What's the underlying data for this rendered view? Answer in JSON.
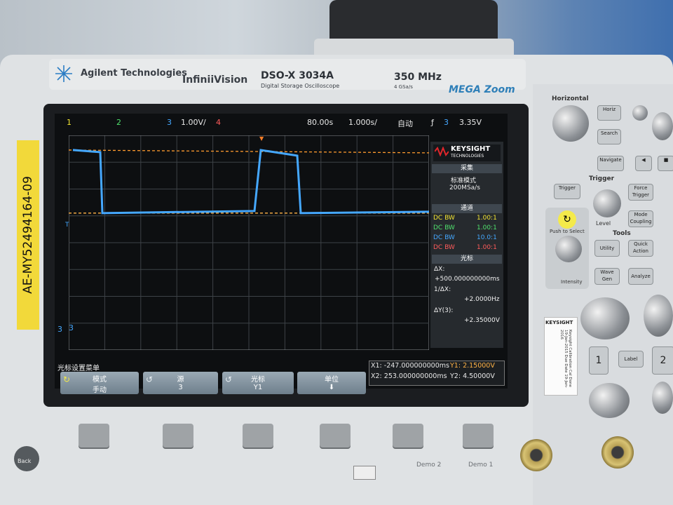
{
  "header": {
    "brand": "Agilent Technologies",
    "series": "InfiniiVision",
    "model": "DSO-X 3034A",
    "model_sub": "Digital Storage Oscilloscope",
    "bandwidth": "350 MHz",
    "sample_rate": "4 GSa/s",
    "feature": "MEGA Zoom"
  },
  "asset_tag": "AE-MY52494164-09",
  "status_bar": {
    "ch1": "1",
    "ch2": "2",
    "ch3": "3",
    "ch3_scale": "1.00V/",
    "ch4": "4",
    "h_position": "80.00s",
    "time_div": "1.000s/",
    "trigger_mode": "自动",
    "trigger_icon": "ƒ",
    "trigger_source": "3",
    "trigger_level": "3.35V"
  },
  "right_panel": {
    "logo_name": "KEYSIGHT",
    "logo_sub": "TECHNOLOGIES",
    "acq_head": "采集",
    "acq_mode": "标准模式",
    "acq_rate": "200MSa/s",
    "channel_head": "通道",
    "channels": [
      {
        "coupling": "DC BW",
        "probe": "1.00:1",
        "color": "#f2e533"
      },
      {
        "coupling": "DC BW",
        "probe": "1.00:1",
        "color": "#4fe16c"
      },
      {
        "coupling": "DC BW",
        "probe": "10.0:1",
        "color": "#45a8ff"
      },
      {
        "coupling": "DC BW",
        "probe": "1.00:1",
        "color": "#ff5b5b"
      }
    ],
    "cursor_head": "光标",
    "delta_x_label": "ΔX:",
    "delta_x": "+500.000000000ms",
    "inv_delta_x_label": "1/ΔX:",
    "inv_delta_x": "+2.0000Hz",
    "delta_y_label": "ΔY(3):",
    "delta_y": "+2.35000V"
  },
  "bottom_bar": {
    "menu_title": "光标设置菜单",
    "softkeys": [
      {
        "label": "模式",
        "value": "手动"
      },
      {
        "label": "源",
        "value": "3"
      },
      {
        "label": "光标",
        "value": "Y1"
      },
      {
        "label": "单位",
        "value": "⬇"
      }
    ],
    "cursors": {
      "x1": "X1: -247.000000000ms",
      "x2": "X2: 253.000000000ms",
      "y1": "Y1: 2.15000V",
      "y2": "Y2: 4.50000V"
    }
  },
  "markers": {
    "trigger_t": "T",
    "ground_3": "3"
  },
  "waveform": {
    "channel": 3,
    "color": "#45a8ff",
    "volts_per_div": 1.0,
    "low_level_v": 2.15,
    "high_level_v": 4.5,
    "cursor_y1_v": 2.15,
    "cursor_y2_v": 4.5
  },
  "controls": {
    "horizontal": "Horizontal",
    "horiz_btn": "Horiz",
    "search_btn": "Search",
    "navigate_btn": "Navigate",
    "trigger": "Trigger",
    "trigger_btn": "Trigger",
    "force_trigger_btn": "Force Trigger",
    "level": "Level",
    "mode_coupling_btn": "Mode Coupling",
    "push_to_select": "Push to Select",
    "tools": "Tools",
    "utility_btn": "Utility",
    "quick_action_btn": "Quick Action",
    "wave_gen_btn": "Wave Gen",
    "analyze_btn": "Analyze",
    "label_btn": "Label",
    "ch1_btn": "1",
    "ch2_btn": "2",
    "intensity": "Intensity",
    "back": "Back"
  },
  "cal_sticker": {
    "brand": "KEYSIGHT",
    "text": "Keysight Calibration Cal Done 19-Jan-2015 Due Date 19-Jan-2016"
  },
  "front": {
    "demo2": "Demo 2",
    "demo1": "Demo 1"
  }
}
